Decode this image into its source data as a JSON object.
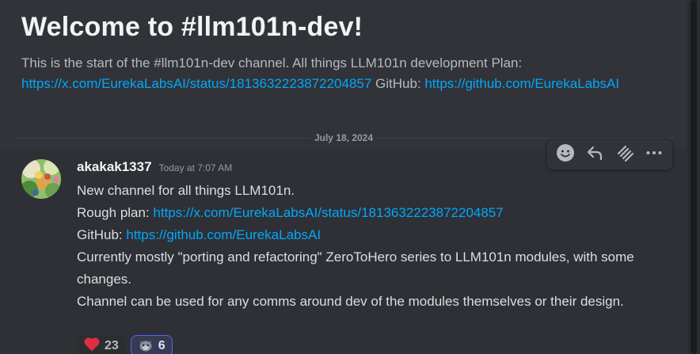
{
  "channel_intro": {
    "title": "Welcome to #llm101n-dev!",
    "description_prefix": "This is the start of the #llm101n-dev channel. All things LLM101n development Plan: ",
    "plan_link": "https://x.com/EurekaLabsAI/status/1813632223872204857",
    "github_label": " GitHub: ",
    "github_link": "https://github.com/EurekaLabsAI"
  },
  "date_divider": "July 18, 2024",
  "message": {
    "username": "akakak1337",
    "timestamp": "Today at 7:07 AM",
    "line1": "New channel for all things LLM101n.",
    "line2_prefix": "Rough plan: ",
    "line2_link": "https://x.com/EurekaLabsAI/status/1813632223872204857",
    "line3_prefix": "GitHub: ",
    "line3_link": "https://github.com/EurekaLabsAI",
    "line4": "Currently mostly \"porting and refactoring\" ZeroToHero series to LLM101n modules, with some changes.",
    "line5": "Channel can be used for any comms around dev of the modules themselves or their design."
  },
  "reactions": [
    {
      "emoji": "heart",
      "count": "23",
      "active": false
    },
    {
      "emoji": "cat-face",
      "count": "6",
      "active": true
    }
  ],
  "toolbar": {
    "icons": [
      "add-reaction-icon",
      "reply-icon",
      "super-reaction-icon",
      "more-options-icon"
    ]
  },
  "colors": {
    "background": "#313338",
    "link": "#00a8fc",
    "accent": "#5865f2",
    "heart": "#dd2e44"
  }
}
